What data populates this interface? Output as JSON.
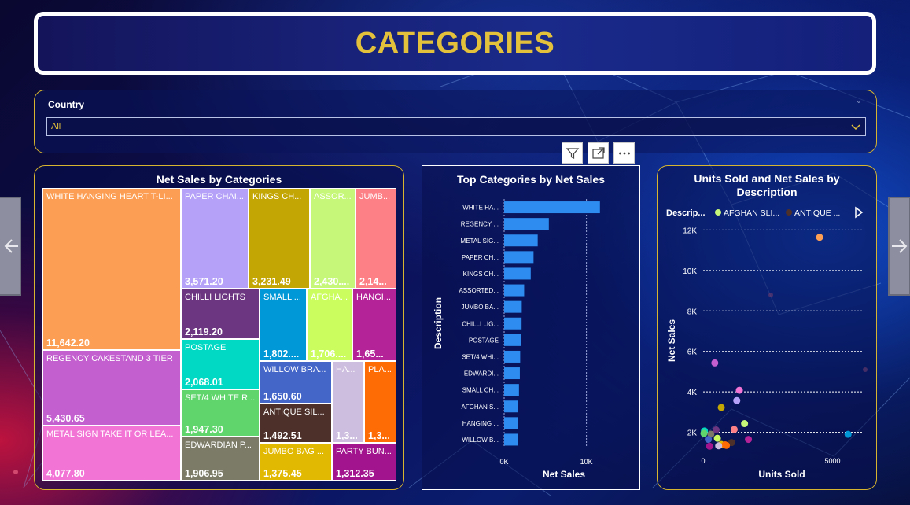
{
  "page": {
    "title": "CATEGORIES"
  },
  "colors": {
    "accent_gold": "#e3c13b",
    "card_border": "#d7b52e",
    "bar_blue": "#2e8cf0"
  },
  "slicer": {
    "label": "Country",
    "value": "All",
    "icon": "chevron-down-icon"
  },
  "visual_tools": {
    "filter_icon": "filter-icon",
    "focus_icon": "focus-mode-icon",
    "more_icon": "more-options-icon"
  },
  "nav": {
    "prev_icon": "arrow-left-icon",
    "next_icon": "arrow-right-icon"
  },
  "treemap": {
    "title": "Net Sales by Categories",
    "cells": [
      {
        "label": "WHITE HANGING HEART T-LI...",
        "value": "11,642.20",
        "color": "#fc9f55"
      },
      {
        "label": "REGENCY CAKESTAND 3 TIER",
        "value": "5,430.65",
        "color": "#c35fcf"
      },
      {
        "label": "METAL SIGN TAKE IT OR LEA...",
        "value": "4,077.80",
        "color": "#f274d5"
      },
      {
        "label": "PAPER CHAI...",
        "value": "3,571.20",
        "color": "#b5a2f8"
      },
      {
        "label": "KINGS CH...",
        "value": "3,231.49",
        "color": "#c3a503"
      },
      {
        "label": "ASSOR...",
        "value": "2,430....",
        "color": "#c6f779"
      },
      {
        "label": "JUMB...",
        "value": "2,14...",
        "color": "#fd8087"
      },
      {
        "label": "CHILLI LIGHTS",
        "value": "2,119.20",
        "color": "#6c3680"
      },
      {
        "label": "POSTAGE",
        "value": "2,068.01",
        "color": "#01d9c4"
      },
      {
        "label": "SET/4 WHITE R...",
        "value": "1,947.30",
        "color": "#5fd56c"
      },
      {
        "label": "EDWARDIAN P...",
        "value": "1,906.95",
        "color": "#7b7b67"
      },
      {
        "label": "SMALL ...",
        "value": "1,802....",
        "color": "#0198d7"
      },
      {
        "label": "AFGHA...",
        "value": "1,706....",
        "color": "#ccfd5e"
      },
      {
        "label": "HANGI...",
        "value": "1,65...",
        "color": "#b42398"
      },
      {
        "label": "WILLOW BRA...",
        "value": "1,650.60",
        "color": "#4466c9"
      },
      {
        "label": "HA...",
        "value": "1,3...",
        "color": "#cdbdde"
      },
      {
        "label": "PLA...",
        "value": "1,3...",
        "color": "#fe6c06"
      },
      {
        "label": "ANTIQUE SIL...",
        "value": "1,492.51",
        "color": "#4d3029"
      },
      {
        "label": "JUMBO BAG ...",
        "value": "1,375.45",
        "color": "#e2b902"
      },
      {
        "label": "PARTY BUN...",
        "value": "1,312.35",
        "color": "#a1148d"
      }
    ]
  },
  "bar_chart": {
    "title": "Top Categories by Net Sales",
    "chart_data": {
      "type": "bar",
      "orientation": "horizontal",
      "title": "Top Categories by Net Sales",
      "xlabel": "Net Sales",
      "ylabel": "Description",
      "categories": [
        "WHITE HA...",
        "REGENCY ...",
        "METAL SIG...",
        "PAPER CH...",
        "KINGS CH...",
        "ASSORTED...",
        "JUMBO BA...",
        "CHILLI LIG...",
        "POSTAGE",
        "SET/4 WHI...",
        "EDWARDI...",
        "SMALL CH...",
        "AFGHAN S...",
        "HANGING ...",
        "WILLOW B..."
      ],
      "values": [
        11642.2,
        5430.65,
        4077.8,
        3571.2,
        3231.49,
        2430,
        2140,
        2119.2,
        2068.01,
        1947.3,
        1906.95,
        1802,
        1706,
        1650,
        1650.6
      ],
      "xlim": [
        0,
        13000
      ],
      "xticks": [
        "0K",
        "10K"
      ],
      "grid": true
    }
  },
  "scatter": {
    "title_line1": "Units Sold and Net Sales by",
    "title_line2": "Description",
    "legend_title": "Descrip...",
    "legend_items": [
      {
        "name": "AFGHAN SLI...",
        "color": "#c6f779"
      },
      {
        "name": "ANTIQUE ...",
        "color": "#4d3029"
      }
    ],
    "legend_more_icon": "play-icon",
    "chart_data": {
      "type": "scatter",
      "title": "Units Sold and Net Sales by Description",
      "xlabel": "Units Sold",
      "ylabel": "Net Sales",
      "xlim": [
        0,
        6200
      ],
      "ylim": [
        700,
        12600
      ],
      "xticks": [
        "0",
        "5000"
      ],
      "yticks": [
        "2K",
        "4K",
        "6K",
        "8K",
        "10K",
        "12K"
      ],
      "grid": true,
      "points": [
        {
          "x": 4500,
          "y": 11642,
          "color": "#fc9f55"
        },
        {
          "x": 5600,
          "y": 1900,
          "color": "#0198d7"
        },
        {
          "x": 450,
          "y": 5430,
          "color": "#c35fcf"
        },
        {
          "x": 1400,
          "y": 4080,
          "color": "#f274d5"
        },
        {
          "x": 1300,
          "y": 3570,
          "color": "#b5a2f8"
        },
        {
          "x": 700,
          "y": 3230,
          "color": "#c3a503"
        },
        {
          "x": 1600,
          "y": 2430,
          "color": "#c6f779"
        },
        {
          "x": 1200,
          "y": 2140,
          "color": "#fd8087"
        },
        {
          "x": 500,
          "y": 2119,
          "color": "#6c3680"
        },
        {
          "x": 50,
          "y": 2068,
          "color": "#01d9c4"
        },
        {
          "x": 30,
          "y": 1947,
          "color": "#5fd56c"
        },
        {
          "x": 300,
          "y": 1907,
          "color": "#7b7b67"
        },
        {
          "x": 550,
          "y": 1706,
          "color": "#ccfd5e"
        },
        {
          "x": 200,
          "y": 1650,
          "color": "#4466c9"
        },
        {
          "x": 1750,
          "y": 1650,
          "color": "#b42398"
        },
        {
          "x": 700,
          "y": 1400,
          "color": "#e2b902"
        },
        {
          "x": 850,
          "y": 1380,
          "color": "#fe6c06"
        },
        {
          "x": 1100,
          "y": 1492,
          "color": "#4d3029"
        },
        {
          "x": 250,
          "y": 1312,
          "color": "#a1148d"
        },
        {
          "x": 600,
          "y": 1330,
          "color": "#cdbdde"
        },
        {
          "x": 900,
          "y": 1350,
          "color": "#fe6c06"
        }
      ]
    }
  }
}
